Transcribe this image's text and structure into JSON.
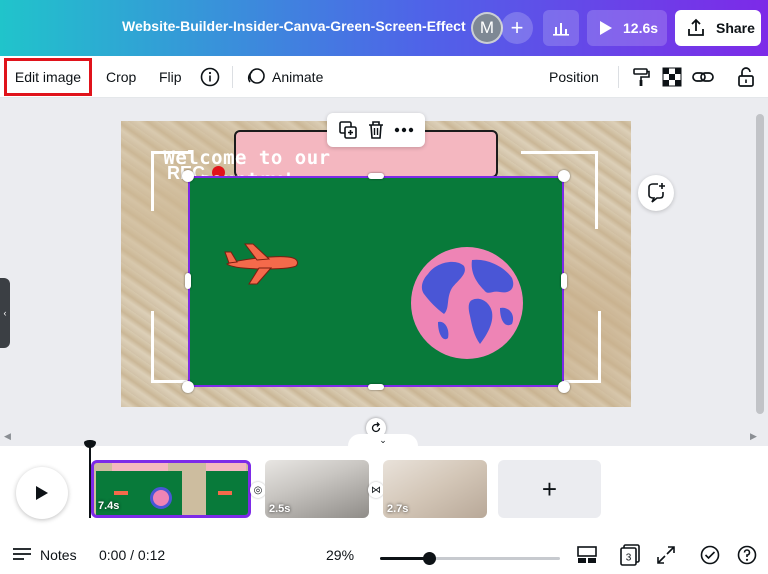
{
  "header": {
    "doc_title": "Website-Builder-Insider-Canva-Green-Screen-Effect",
    "avatar_initial": "M",
    "add_collaborator": "+",
    "present_duration": "12.6s",
    "share_label": "Share"
  },
  "toolbar": {
    "edit_image": "Edit image",
    "crop": "Crop",
    "flip": "Flip",
    "animate": "Animate",
    "position": "Position"
  },
  "design": {
    "banner_text": "Welcome to our country!",
    "rec_label": "REC"
  },
  "timeline": {
    "clips": [
      {
        "duration": "7.4s"
      },
      {
        "duration": "2.5s"
      },
      {
        "duration": "2.7s"
      }
    ],
    "add_clip": "+"
  },
  "footer": {
    "notes_label": "Notes",
    "time": "0:00 / 0:12",
    "zoom": "29%",
    "zoom_fraction": 0.27,
    "page_count": "3"
  },
  "colors": {
    "accent_purple": "#7d2ae8",
    "green_screen": "#087a3a",
    "highlight_red": "#e0131b"
  }
}
